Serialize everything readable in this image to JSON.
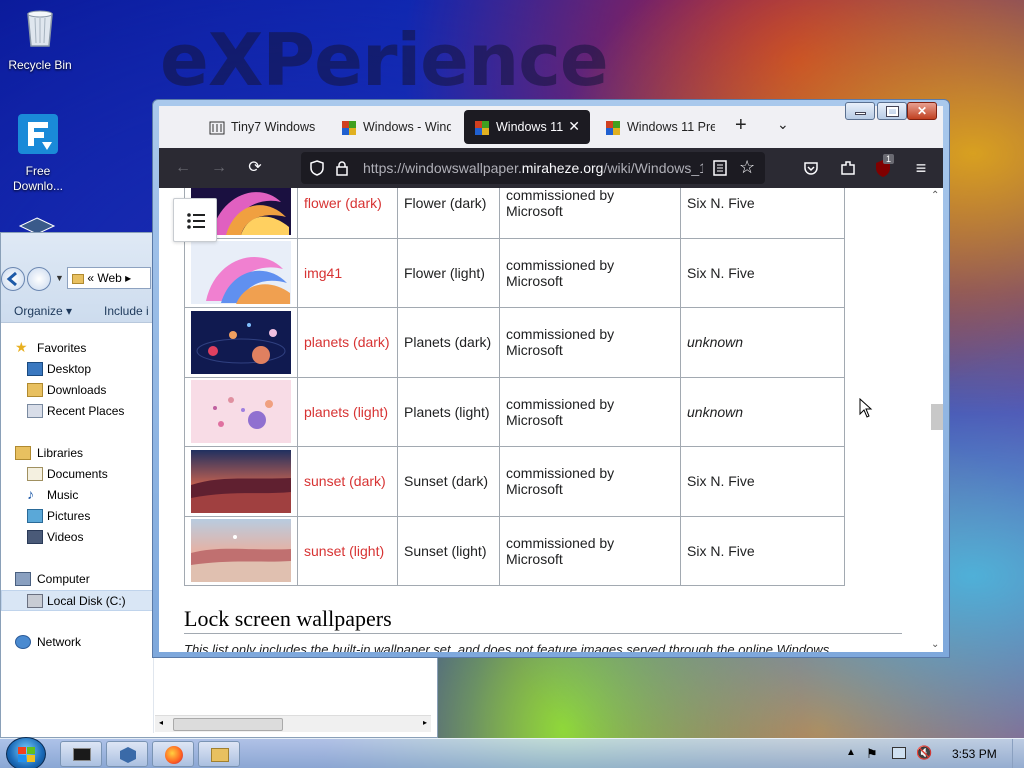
{
  "desktop": {
    "wallpaper_text": "eXPerience",
    "icons": [
      {
        "label": "Recycle Bin"
      },
      {
        "label": "Free Downlo..."
      }
    ]
  },
  "explorer": {
    "address_label": "« Web",
    "toolbar": {
      "organize": "Organize ▾",
      "include": "Include i"
    },
    "sidebar": {
      "favorites": "Favorites",
      "desktop": "Desktop",
      "downloads": "Downloads",
      "recent_places": "Recent Places",
      "libraries": "Libraries",
      "documents": "Documents",
      "music": "Music",
      "pictures": "Pictures",
      "videos": "Videos",
      "computer": "Computer",
      "local_disk": "Local Disk (C:)",
      "network": "Network"
    }
  },
  "browser": {
    "tabs": [
      {
        "label": "Tiny7 Windows"
      },
      {
        "label": "Windows - Wind"
      },
      {
        "label": "Windows 11",
        "active": true
      },
      {
        "label": "Windows 11 Pre"
      }
    ],
    "url_prefix": "https://windowswallpaper.",
    "url_host": "miraheze.org",
    "url_suffix": "/wiki/Windows_1",
    "notification_count": "1",
    "table_rows": [
      {
        "name": "flower (dark)",
        "description": "Flower (dark)",
        "license": "commissioned by Microsoft",
        "author": "Six N. Five",
        "author_italic": false,
        "theme": "flower-dark"
      },
      {
        "name": "img41",
        "description": "Flower (light)",
        "license": "commissioned by Microsoft",
        "author": "Six N. Five",
        "author_italic": false,
        "theme": "flower-light"
      },
      {
        "name": "planets (dark)",
        "description": "Planets (dark)",
        "license": "commissioned by Microsoft",
        "author": "unknown",
        "author_italic": true,
        "theme": "planets-dark"
      },
      {
        "name": "planets (light)",
        "description": "Planets (light)",
        "license": "commissioned by Microsoft",
        "author": "unknown",
        "author_italic": true,
        "theme": "planets-light"
      },
      {
        "name": "sunset (dark)",
        "description": "Sunset (dark)",
        "license": "commissioned by Microsoft",
        "author": "Six N. Five",
        "author_italic": false,
        "theme": "sunset-dark"
      },
      {
        "name": "sunset (light)",
        "description": "Sunset (light)",
        "license": "commissioned by Microsoft",
        "author": "Six N. Five",
        "author_italic": false,
        "theme": "sunset-light"
      }
    ],
    "section_heading": "Lock screen wallpapers",
    "section_paragraph": "This list only includes the built-in wallpaper set, and does not feature images served through the online Windows"
  },
  "taskbar": {
    "clock": "3:53 PM"
  },
  "colors": {
    "redlink": "#d73333",
    "browser_toolbar": "#2b2a33",
    "active_tab": "#1c1b22"
  }
}
